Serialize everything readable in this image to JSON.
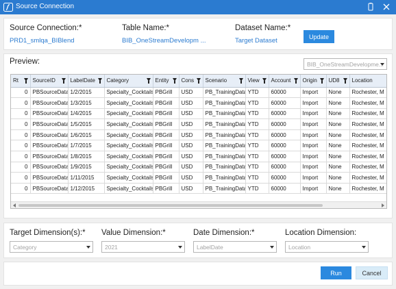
{
  "window": {
    "title": "Source Connection"
  },
  "header": {
    "source_connection_label": "Source Connection:*",
    "source_connection_value": "PRD1_smlqa_BIBlend",
    "table_name_label": "Table Name:*",
    "table_name_value": "BIB_OneStreamDevelopm ...",
    "dataset_name_label": "Dataset Name:*",
    "dataset_name_value": "Target Dataset",
    "update_label": "Update"
  },
  "preview": {
    "label": "Preview:",
    "table_select": "BIB_OneStreamDevelopme...",
    "columns": [
      "Rt",
      "SourceID",
      "LabelDate",
      "Category",
      "Entity",
      "Cons",
      "Scenario",
      "View",
      "Account",
      "Origin",
      "UD8",
      "Location"
    ],
    "rows": [
      [
        "0",
        "PBSourceData",
        "1/2/2015",
        "Specialty_Cocktails",
        "PBGrill",
        "USD",
        "PB_TrainingData",
        "YTD",
        "60000",
        "Import",
        "None",
        "Rochester, M"
      ],
      [
        "0",
        "PBSourceData",
        "1/3/2015",
        "Specialty_Cocktails",
        "PBGrill",
        "USD",
        "PB_TrainingData",
        "YTD",
        "60000",
        "Import",
        "None",
        "Rochester, M"
      ],
      [
        "0",
        "PBSourceData",
        "1/4/2015",
        "Specialty_Cocktails",
        "PBGrill",
        "USD",
        "PB_TrainingData",
        "YTD",
        "60000",
        "Import",
        "None",
        "Rochester, M"
      ],
      [
        "0",
        "PBSourceData",
        "1/5/2015",
        "Specialty_Cocktails",
        "PBGrill",
        "USD",
        "PB_TrainingData",
        "YTD",
        "60000",
        "Import",
        "None",
        "Rochester, M"
      ],
      [
        "0",
        "PBSourceData",
        "1/6/2015",
        "Specialty_Cocktails",
        "PBGrill",
        "USD",
        "PB_TrainingData",
        "YTD",
        "60000",
        "Import",
        "None",
        "Rochester, M"
      ],
      [
        "0",
        "PBSourceData",
        "1/7/2015",
        "Specialty_Cocktails",
        "PBGrill",
        "USD",
        "PB_TrainingData",
        "YTD",
        "60000",
        "Import",
        "None",
        "Rochester, M"
      ],
      [
        "0",
        "PBSourceData",
        "1/8/2015",
        "Specialty_Cocktails",
        "PBGrill",
        "USD",
        "PB_TrainingData",
        "YTD",
        "60000",
        "Import",
        "None",
        "Rochester, M"
      ],
      [
        "0",
        "PBSourceData",
        "1/9/2015",
        "Specialty_Cocktails",
        "PBGrill",
        "USD",
        "PB_TrainingData",
        "YTD",
        "60000",
        "Import",
        "None",
        "Rochester, M"
      ],
      [
        "0",
        "PBSourceData",
        "1/11/2015",
        "Specialty_Cocktails",
        "PBGrill",
        "USD",
        "PB_TrainingData",
        "YTD",
        "60000",
        "Import",
        "None",
        "Rochester, M"
      ],
      [
        "0",
        "PBSourceData",
        "1/12/2015",
        "Specialty_Cocktails",
        "PBGrill",
        "USD",
        "PB_TrainingData",
        "YTD",
        "60000",
        "Import",
        "None",
        "Rochester, M"
      ]
    ]
  },
  "dimensions": {
    "target_label": "Target Dimension(s):*",
    "target_value": "Category",
    "value_label": "Value Dimension:*",
    "value_value": "2021",
    "date_label": "Date Dimension:*",
    "date_value": "LabelDate",
    "location_label": "Location Dimension:",
    "location_value": "Location"
  },
  "actions": {
    "run_label": "Run",
    "cancel_label": "Cancel"
  },
  "colors": {
    "titlebar": "#2b7bd0",
    "accent": "#2b89df",
    "link": "#2b7bd0"
  }
}
